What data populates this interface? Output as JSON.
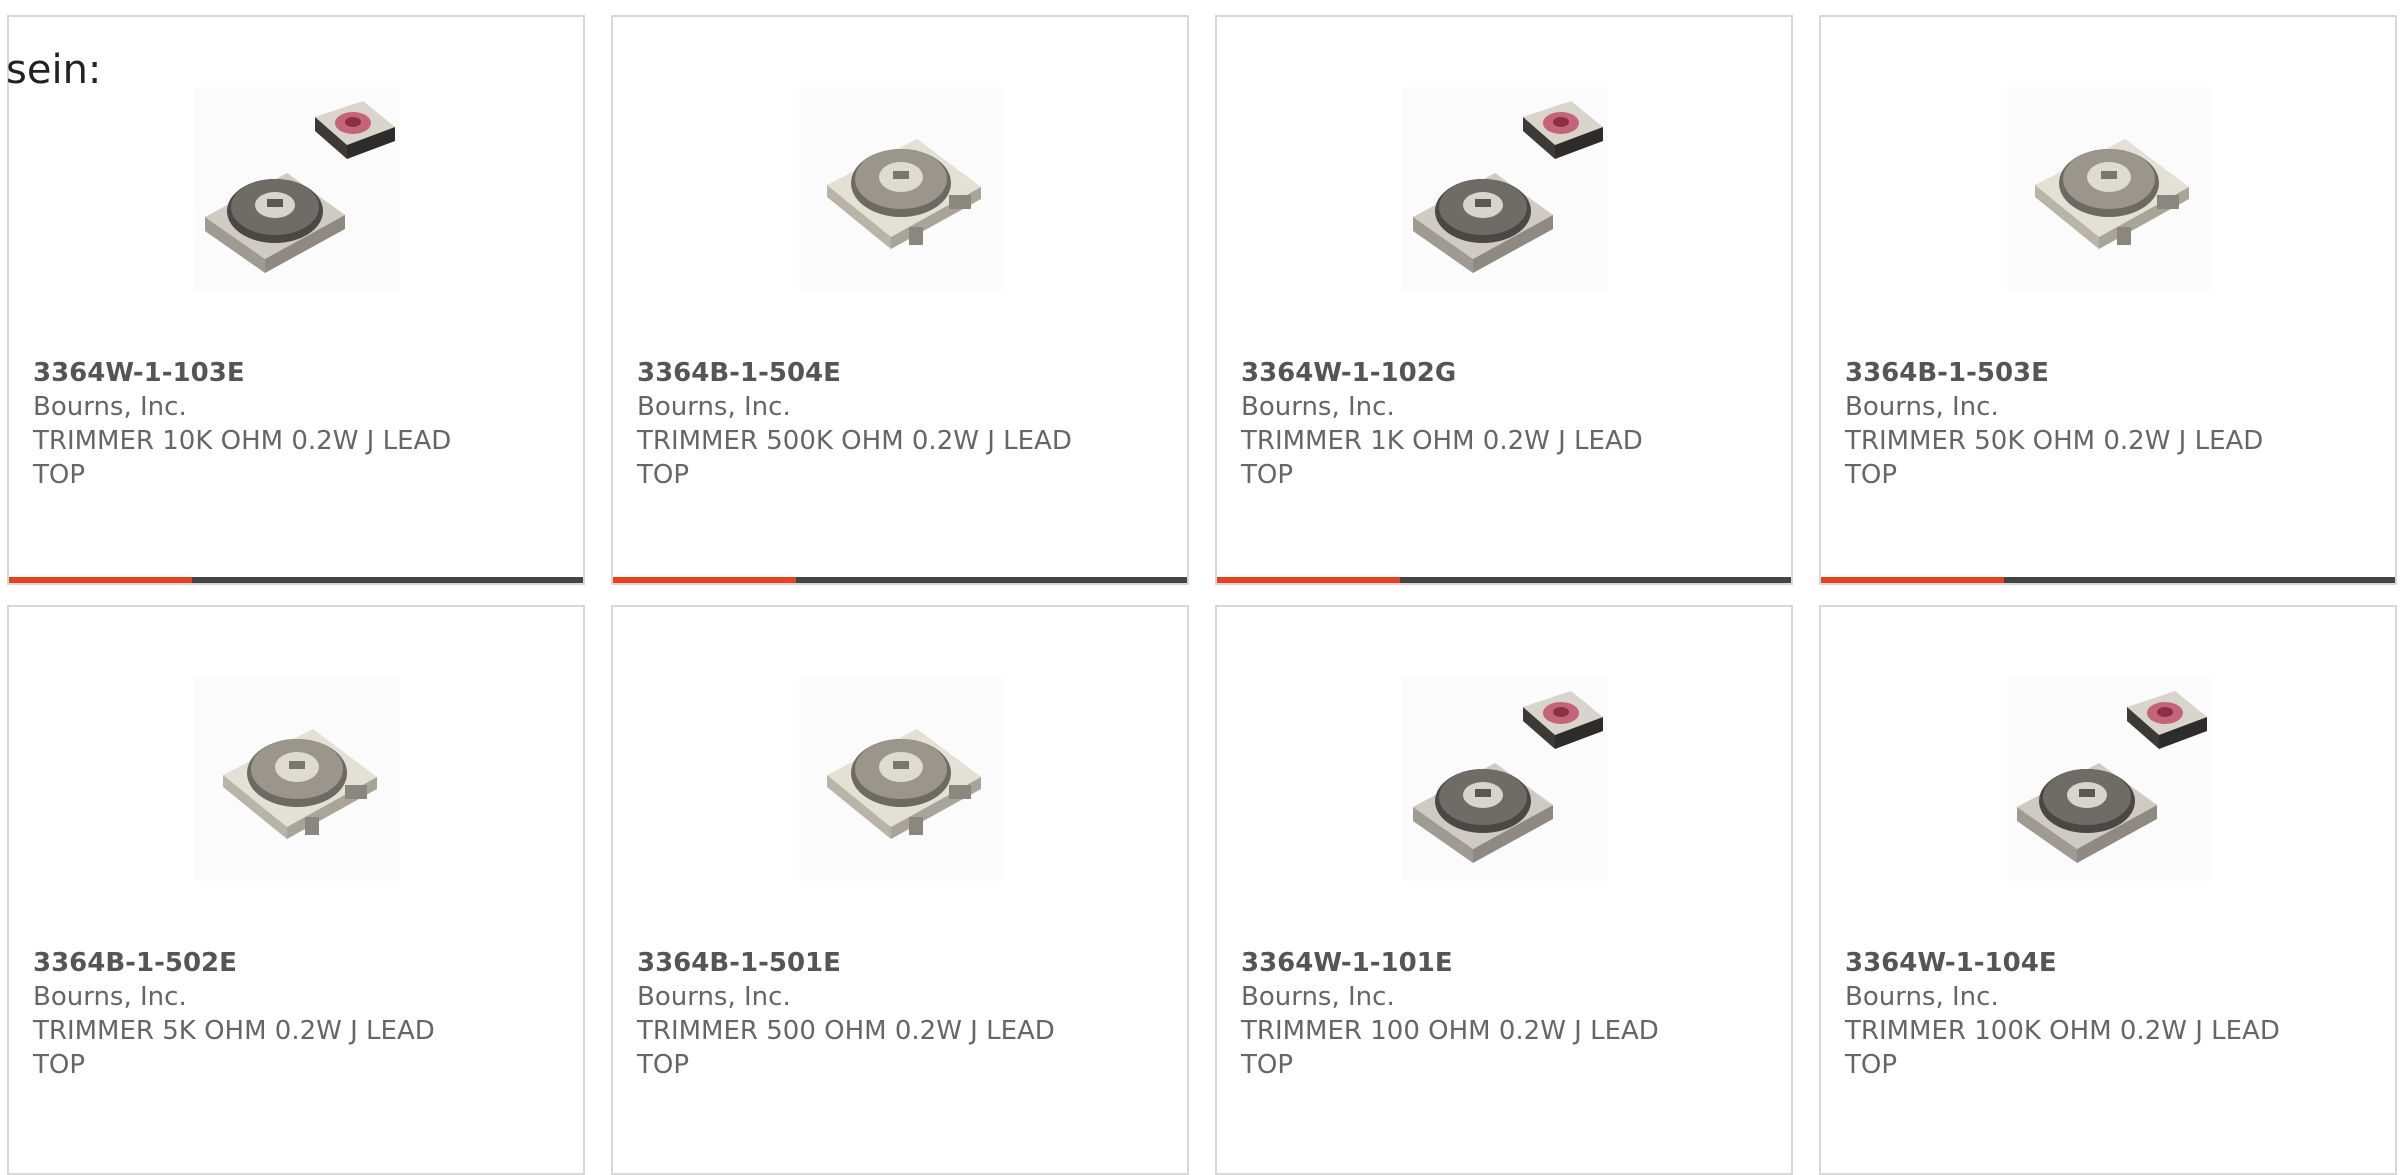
{
  "intro_text": "sein:",
  "products": [
    {
      "part": "3364W-1-103E",
      "manufacturer": "Bourns, Inc.",
      "description": "TRIMMER 10K OHM 0.2W J LEAD TOP",
      "image": "trimmer-pair"
    },
    {
      "part": "3364B-1-504E",
      "manufacturer": "Bourns, Inc.",
      "description": "TRIMMER 500K OHM 0.2W J LEAD TOP",
      "image": "trimmer-single"
    },
    {
      "part": "3364W-1-102G",
      "manufacturer": "Bourns, Inc.",
      "description": "TRIMMER 1K OHM 0.2W J LEAD TOP",
      "image": "trimmer-pair"
    },
    {
      "part": "3364B-1-503E",
      "manufacturer": "Bourns, Inc.",
      "description": "TRIMMER 50K OHM 0.2W J LEAD TOP",
      "image": "trimmer-single"
    },
    {
      "part": "3364B-1-502E",
      "manufacturer": "Bourns, Inc.",
      "description": "TRIMMER 5K OHM 0.2W J LEAD TOP",
      "image": "trimmer-single"
    },
    {
      "part": "3364B-1-501E",
      "manufacturer": "Bourns, Inc.",
      "description": "TRIMMER 500 OHM 0.2W J LEAD TOP",
      "image": "trimmer-single"
    },
    {
      "part": "3364W-1-101E",
      "manufacturer": "Bourns, Inc.",
      "description": "TRIMMER 100 OHM 0.2W J LEAD TOP",
      "image": "trimmer-pair"
    },
    {
      "part": "3364W-1-104E",
      "manufacturer": "Bourns, Inc.",
      "description": "TRIMMER 100K OHM 0.2W J LEAD TOP",
      "image": "trimmer-pair"
    }
  ],
  "colors": {
    "accent": "#e8411f",
    "bar": "#444444",
    "border": "#d8d8d8",
    "text": "#666666"
  }
}
